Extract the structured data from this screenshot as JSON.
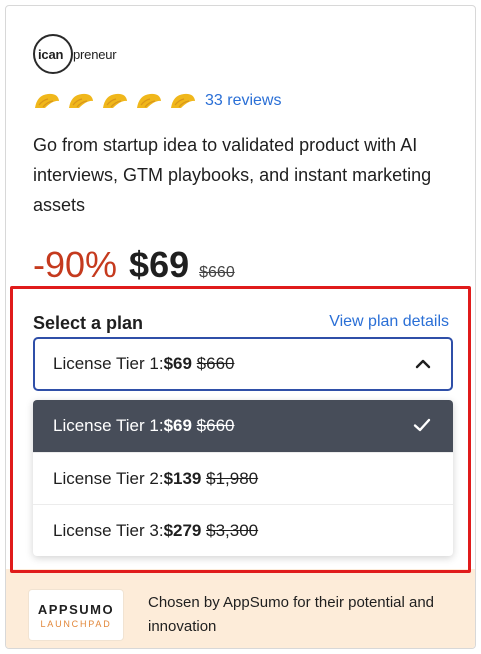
{
  "brand": {
    "logo_circle_text": "ican",
    "logo_rest_text": "preneur"
  },
  "rating": {
    "score": 5,
    "max": 5,
    "icon": "taco-icon",
    "reviews_text": "33 reviews"
  },
  "description": "Go from startup idea to validated product with AI interviews, GTM playbooks, and instant marketing assets",
  "pricing": {
    "discount": "-90%",
    "price": "$69",
    "original_price": "$660"
  },
  "plan": {
    "label": "Select a plan",
    "details_link": "View plan details",
    "selected": {
      "label": "License Tier 1: ",
      "price": "$69",
      "original": "$660"
    },
    "options": [
      {
        "label": "License Tier 1: ",
        "price": "$69",
        "original": "$660",
        "selected": true
      },
      {
        "label": "License Tier 2: ",
        "price": "$139",
        "original": "$1,980",
        "selected": false
      },
      {
        "label": "License Tier 3: ",
        "price": "$279",
        "original": "$3,300",
        "selected": false
      }
    ]
  },
  "footer": {
    "badge_line1": "APPSUMO",
    "badge_line2": "LAUNCHPAD",
    "text": "Chosen by AppSumo for their potential and innovation"
  },
  "colors": {
    "accent_link": "#2a6fd6",
    "discount": "#c53a1e",
    "highlight_border": "#e01b1b",
    "selected_option_bg": "#474d59",
    "footer_bg": "#fdecd9",
    "taco": "#f0b71b"
  }
}
